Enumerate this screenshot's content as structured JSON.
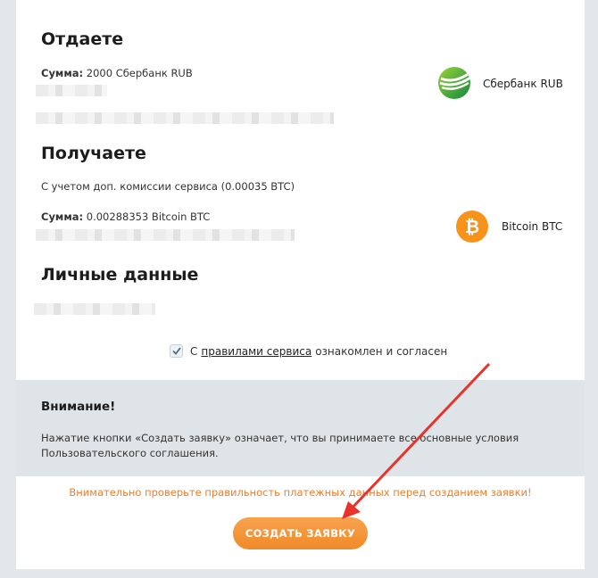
{
  "give": {
    "title": "Отдаете",
    "sum_label": "Сумма:",
    "sum_value": "2000 Сбербанк RUB",
    "method_name": "Сбербанк RUB",
    "method_icon": "sberbank-logo-icon"
  },
  "receive": {
    "title": "Получаете",
    "fee_note": "С учетом доп. комиссии сервиса (0.00035 BTC)",
    "sum_label": "Сумма:",
    "sum_value": "0.00288353 Bitcoin BTC",
    "method_name": "Bitcoin BTC",
    "method_icon": "bitcoin-logo-icon"
  },
  "personal": {
    "title": "Личные данные"
  },
  "consent": {
    "prefix": "С",
    "link": "правилами сервиса",
    "suffix": "ознакомлен и согласен",
    "checked": true
  },
  "notice": {
    "title": "Внимание!",
    "text": "Нажатие кнопки «Создать заявку» означает, что вы принимаете все основные условия Пользовательского соглашения."
  },
  "warning": "Внимательно проверьте правильность платежных данных перед созданием заявки!",
  "submit_label": "СОЗДАТЬ ЗАЯВКУ",
  "colors": {
    "accent": "#f08a28",
    "warning": "#f07d2a",
    "notice_bg": "#dfe4e8",
    "sber_green": "#21a038",
    "bitcoin_orange": "#f7931a",
    "arrow_red": "#e8322a"
  }
}
